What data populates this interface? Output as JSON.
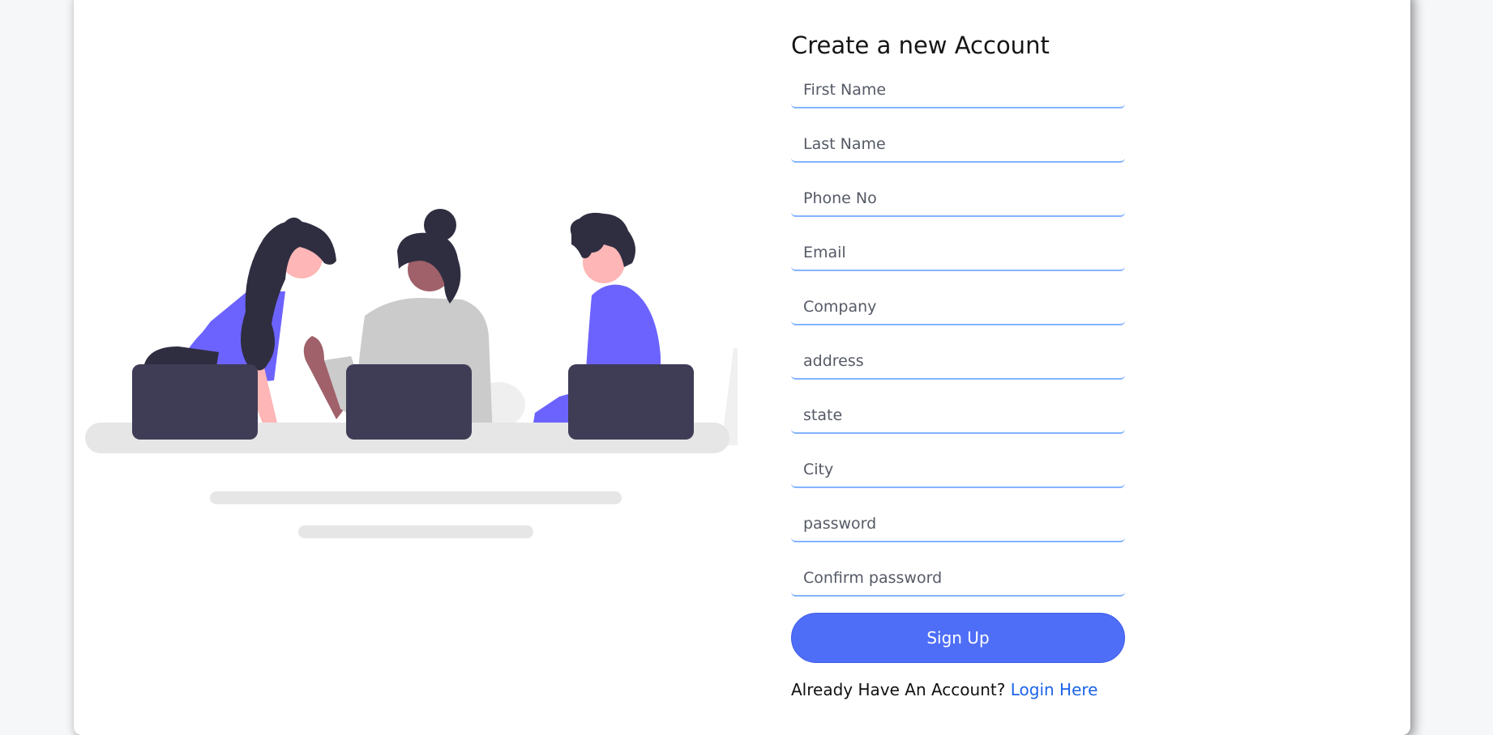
{
  "form": {
    "title": "Create a new Account",
    "fields": [
      {
        "placeholder": "First Name",
        "value": ""
      },
      {
        "placeholder": "Last Name",
        "value": ""
      },
      {
        "placeholder": "Phone No",
        "value": ""
      },
      {
        "placeholder": "Email",
        "value": ""
      },
      {
        "placeholder": "Company",
        "value": ""
      },
      {
        "placeholder": "address",
        "value": ""
      },
      {
        "placeholder": "state",
        "value": ""
      },
      {
        "placeholder": "City",
        "value": ""
      },
      {
        "placeholder": "password",
        "value": ""
      },
      {
        "placeholder": "Confirm password",
        "value": ""
      }
    ],
    "submit_label": "Sign Up",
    "login_prompt": "Already Have An Account?",
    "login_link": "Login Here"
  },
  "colors": {
    "accent": "#4f6ef7",
    "field_underline": "#83b4ff",
    "link": "#1c64e8",
    "illustration_purple": "#6c63ff",
    "illustration_dark": "#3f3d56"
  }
}
